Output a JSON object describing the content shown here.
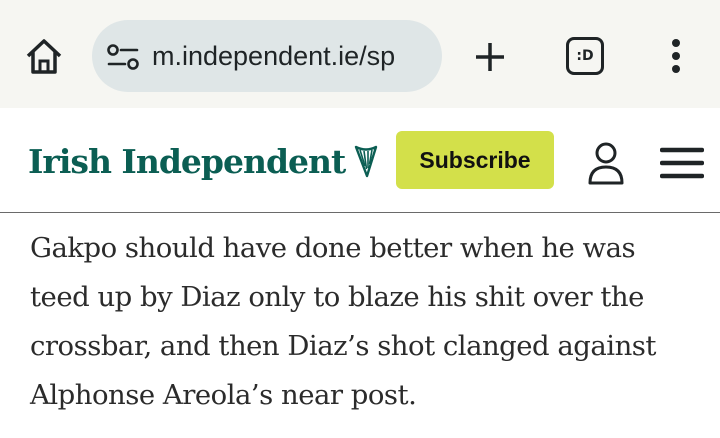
{
  "browser": {
    "url": "m.independent.ie/sp",
    "tabs_label": ":D"
  },
  "site": {
    "logo_text": "Irish Independent",
    "subscribe_label": "Subscribe",
    "brand_color": "#0b5e53",
    "accent_color": "#d3e04a"
  },
  "article": {
    "lines": [
      "Gakpo should have done better when he was",
      "teed up by Diaz only to blaze his shit over the",
      "crossbar, and then Diaz’s shot clanged against",
      "Alphonse Areola’s near post."
    ]
  },
  "icons": [
    "home-icon",
    "site-settings-icon",
    "plus-icon",
    "tabs-icon",
    "more-vert-icon",
    "harp-icon",
    "account-icon",
    "hamburger-menu-icon"
  ]
}
